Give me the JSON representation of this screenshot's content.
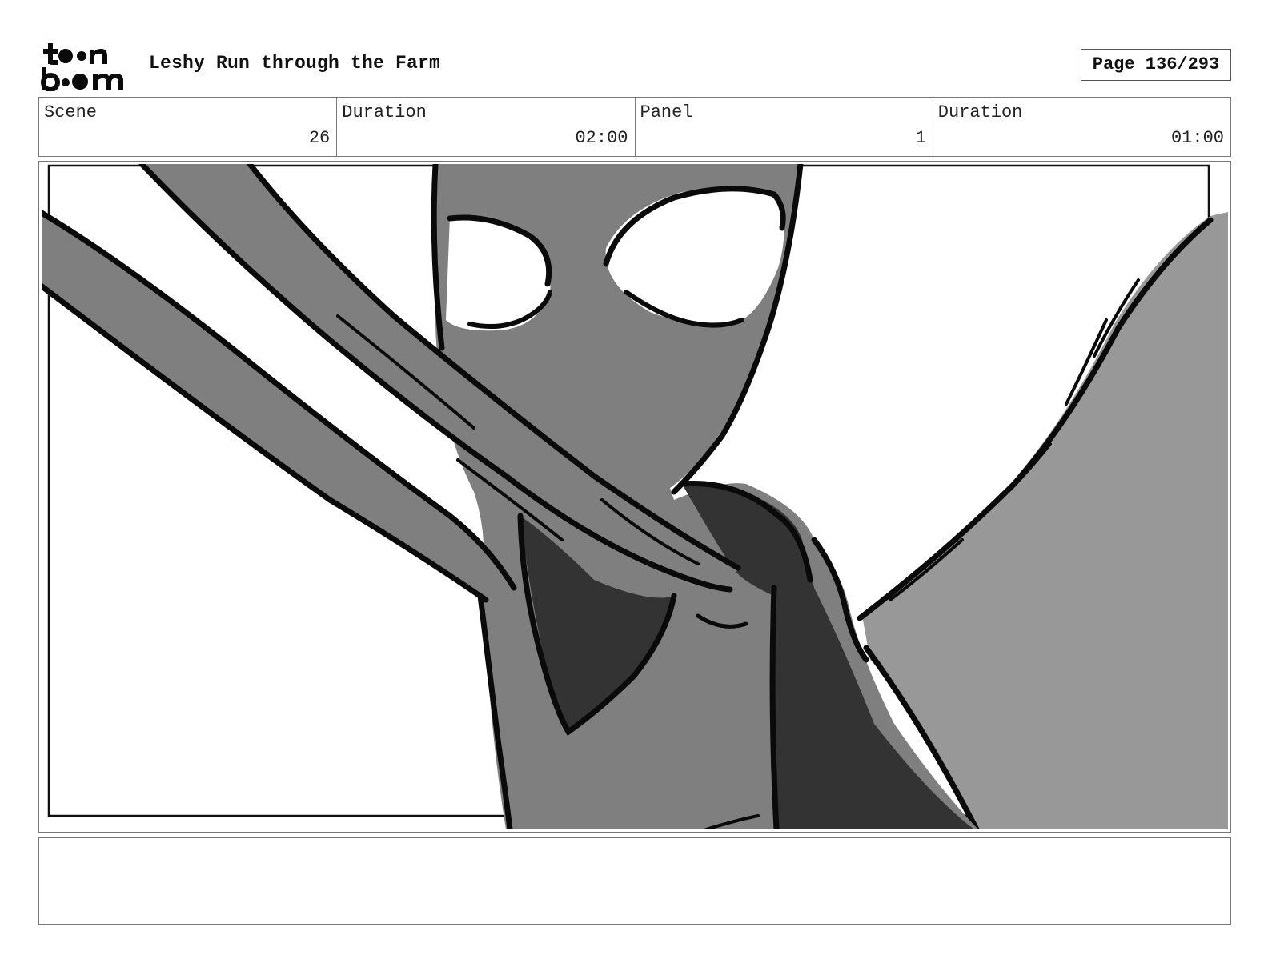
{
  "header": {
    "logo_text": "toon boom",
    "title": "Leshy Run through the Farm",
    "page_indicator": "Page 136/293"
  },
  "info": {
    "scene_label": "Scene",
    "scene_value": "26",
    "scene_duration_label": "Duration",
    "scene_duration_value": "02:00",
    "panel_label": "Panel",
    "panel_value": "1",
    "panel_duration_label": "Duration",
    "panel_duration_value": "01:00"
  },
  "panel": {
    "image_description_icon": "storyboard-sketch-leshy-arms-reaching",
    "fill_colors": {
      "body_gray": "#7f7f7f",
      "light_gray": "#989898",
      "dark_gray": "#333333",
      "ink": "#0a0a0a",
      "paper": "#ffffff"
    }
  },
  "notes": {
    "text": ""
  }
}
